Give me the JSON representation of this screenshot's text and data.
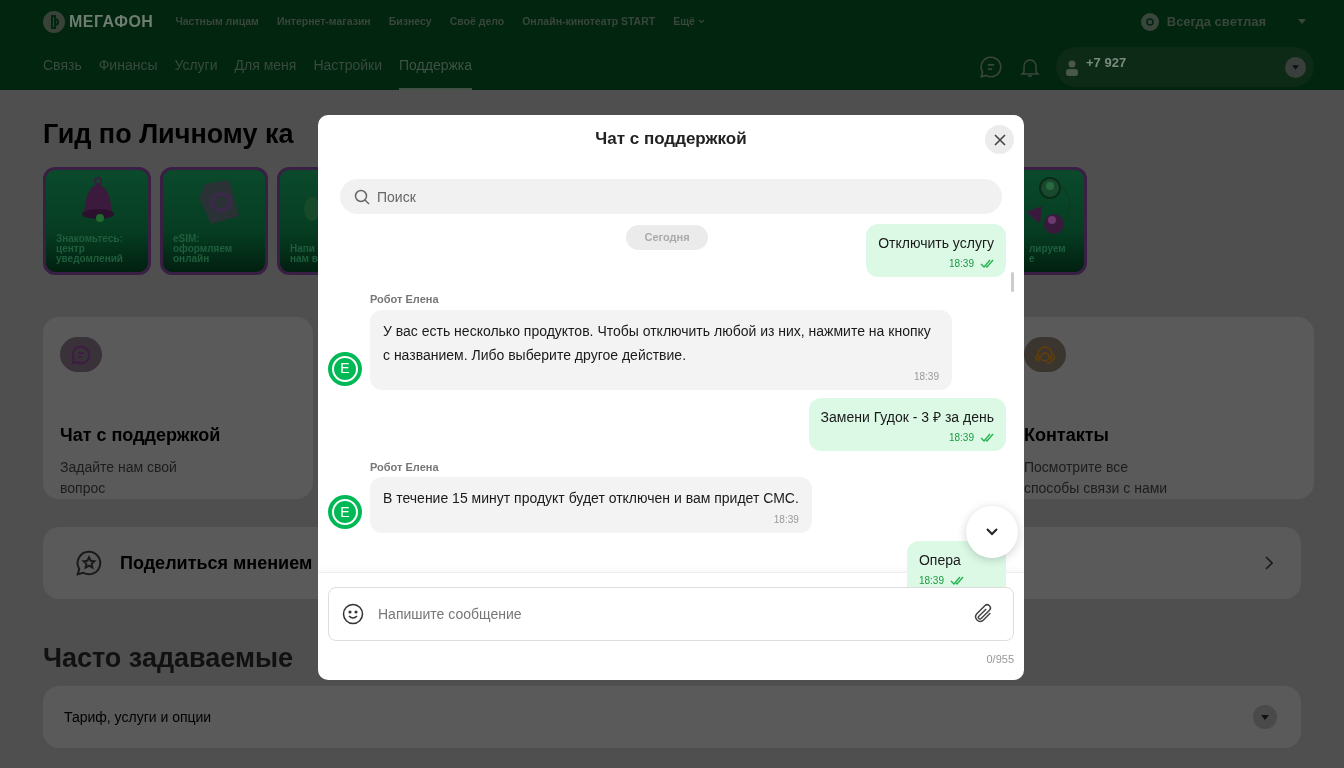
{
  "header": {
    "logo": "МЕГАФОН",
    "top_nav": [
      {
        "label": "Частным лицам"
      },
      {
        "label": "Интернет-магазин"
      },
      {
        "label": "Бизнесу"
      },
      {
        "label": "Своё дело"
      },
      {
        "label": "Онлайн-кинотеатр START"
      }
    ],
    "more": "Ещё",
    "theme": "Всегда светлая",
    "main_nav": [
      {
        "label": "Связь",
        "selected": false
      },
      {
        "label": "Финансы",
        "selected": false
      },
      {
        "label": "Услуги",
        "selected": false
      },
      {
        "label": "Для меня",
        "selected": false
      },
      {
        "label": "Настройки",
        "selected": false
      },
      {
        "label": "Поддержка",
        "selected": true
      }
    ],
    "phone": "+7 927"
  },
  "page": {
    "title": "Гид по Личному ка",
    "stories": [
      {
        "kind": "bell",
        "lines": [
          "Знакомьтесь:",
          "центр",
          "уведомлений"
        ]
      },
      {
        "kind": "sim",
        "lines": [
          "eSIM:",
          "оформляем",
          "онлайн"
        ]
      },
      {
        "kind": "chat",
        "lines": [
          "Напи",
          "нам в"
        ]
      },
      {
        "kind": "hidden"
      },
      {
        "kind": "hidden"
      },
      {
        "kind": "hidden"
      },
      {
        "kind": "hidden"
      },
      {
        "kind": "hidden"
      },
      {
        "kind": "people",
        "lines": [
          "лируем",
          "е"
        ]
      }
    ],
    "help_cards": [
      {
        "kind": "chat",
        "title": "Чат с поддержкой",
        "description": "Задайте нам свой вопрос"
      },
      {
        "kind": "hidden"
      },
      {
        "kind": "hidden"
      },
      {
        "kind": "contacts",
        "title": "Контакты",
        "description": "Посмотрите все способы связи с нами"
      }
    ],
    "share": "Поделиться мнением",
    "faq_title": "Часто задаваемые",
    "faq_items": [
      {
        "label": "Тариф, услуги и опции",
        "expanded": false
      }
    ]
  },
  "chat": {
    "title": "Чат с поддержкой",
    "search_placeholder": "Поиск",
    "date": "Сегодня",
    "messages": [
      {
        "kind": "user",
        "text": "Отключить услугу",
        "time": "18:39",
        "read": true
      },
      {
        "kind": "bot",
        "author": "Робот Елена",
        "avatar": "Е",
        "text": "У вас есть несколько продуктов. Чтобы отключить любой из них, нажмите на кнопку с названием. Либо выберите другое действие.",
        "time": "18:39"
      },
      {
        "kind": "user",
        "text": "Замени Гудок - 3 ₽ за день",
        "time": "18:39",
        "read": true
      },
      {
        "kind": "bot",
        "author": "Робот Елена",
        "avatar": "Е",
        "text": "В течение 15 минут продукт будет отключен и вам придет СМС.",
        "time": "18:39"
      },
      {
        "kind": "user",
        "text": "Опера",
        "time": "18:39",
        "read": true
      }
    ],
    "input_placeholder": "Напишите сообщение",
    "counter": "0/955"
  }
}
